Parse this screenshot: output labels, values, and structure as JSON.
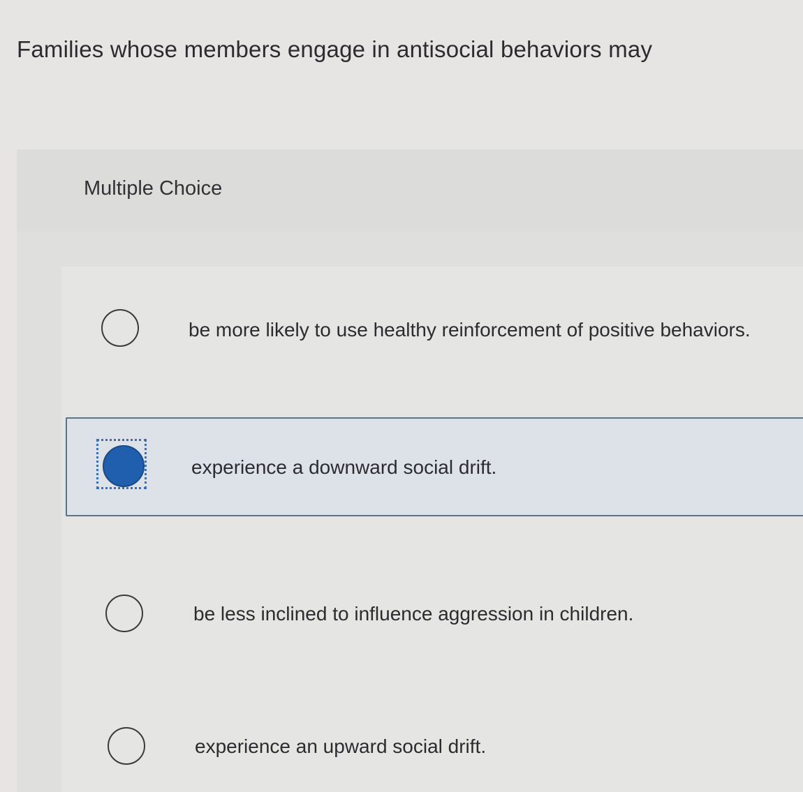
{
  "question": {
    "text": "Families whose members engage in antisocial behaviors may"
  },
  "header": {
    "label": "Multiple Choice"
  },
  "options": [
    {
      "text": "be more likely to use healthy reinforcement of positive behaviors.",
      "selected": false
    },
    {
      "text": "experience a downward social drift.",
      "selected": true
    },
    {
      "text": "be less inclined to influence aggression in children.",
      "selected": false
    },
    {
      "text": "experience an upward social drift.",
      "selected": false
    }
  ],
  "colors": {
    "selected_fill": "#1f5fae",
    "selected_background": "#dde2e8",
    "selected_border": "#5d7388"
  }
}
